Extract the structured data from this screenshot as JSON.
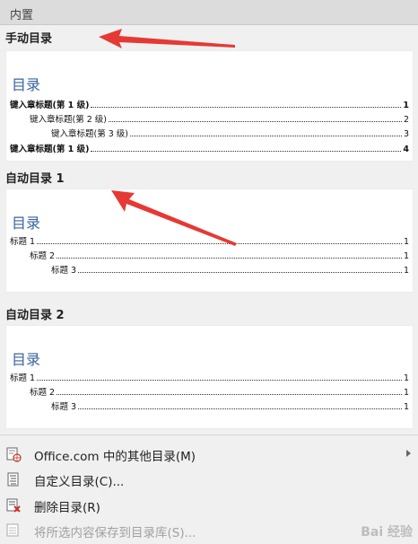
{
  "header": {
    "title": "内置"
  },
  "groups": [
    {
      "title": "手动目录",
      "toc_title": "目录",
      "rows": [
        {
          "text": "键入章标题(第 1 级)",
          "page": "1"
        },
        {
          "text": "键入章标题(第 2 级)",
          "page": "2"
        },
        {
          "text": "键入章标题(第 3 级)",
          "page": "3"
        },
        {
          "text": "键入章标题(第 1 级)",
          "page": "4"
        }
      ]
    },
    {
      "title": "自动目录 1",
      "toc_title": "目录",
      "rows": [
        {
          "text": "标题 1",
          "page": "1"
        },
        {
          "text": "标题 2",
          "page": "1"
        },
        {
          "text": "标题 3",
          "page": "1"
        }
      ]
    },
    {
      "title": "自动目录 2",
      "toc_title": "目录",
      "rows": [
        {
          "text": "标题 1",
          "page": "1"
        },
        {
          "text": "标题 2",
          "page": "1"
        },
        {
          "text": "标题 3",
          "page": "1"
        }
      ]
    }
  ],
  "menu": [
    {
      "label": "Office.com 中的其他目录(M)",
      "icon": "office-globe-icon",
      "has_submenu": true,
      "enabled": true
    },
    {
      "label": "自定义目录(C)...",
      "icon": "custom-toc-icon",
      "has_submenu": false,
      "enabled": true
    },
    {
      "label": "删除目录(R)",
      "icon": "delete-toc-icon",
      "has_submenu": false,
      "enabled": true
    },
    {
      "label": "将所选内容保存到目录库(S)...",
      "icon": "save-selection-icon",
      "has_submenu": false,
      "enabled": false
    }
  ],
  "colors": {
    "toc_title": "#3a64a0",
    "annotation_arrow": "#e53935",
    "delete_icon": "#d32f2f"
  }
}
